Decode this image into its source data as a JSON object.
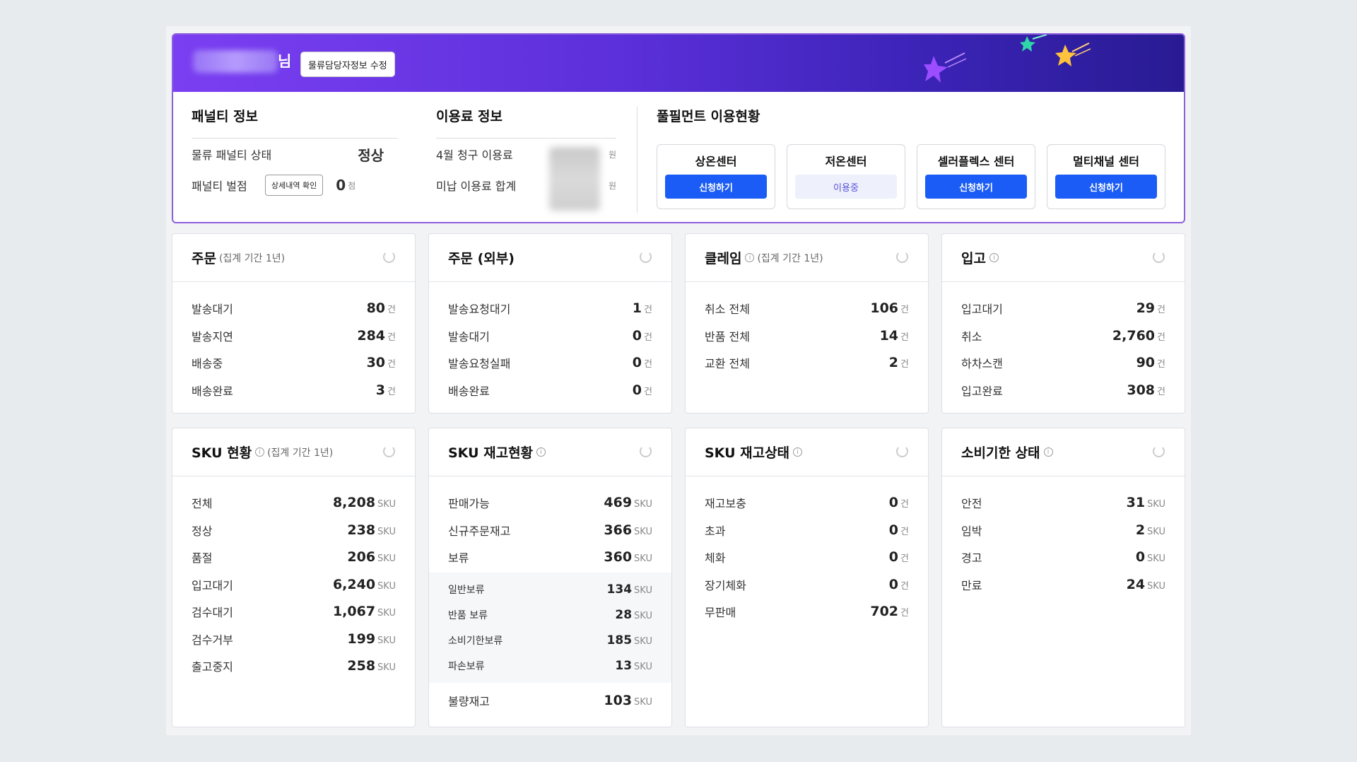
{
  "header": {
    "suffix": "님",
    "edit_button": "물류담당자정보 수정"
  },
  "penalty": {
    "title": "패널티 정보",
    "status_label": "물류 패널티 상태",
    "status_value": "정상",
    "points_label": "패널티 벌점",
    "detail_button": "상세내역 확인",
    "points_value": "0",
    "points_unit": "점"
  },
  "fee": {
    "title": "이용료 정보",
    "row1_label": "4월 청구 이용료",
    "row1_unit": "원",
    "row2_label": "미납 이용료 합계",
    "row2_unit": "원"
  },
  "fulfillment": {
    "title": "풀필먼트 이용현황",
    "centers": [
      {
        "name": "상온센터",
        "button": "신청하기"
      },
      {
        "name": "저온센터",
        "button": "이용중"
      },
      {
        "name": "셀러플렉스 센터",
        "button": "신청하기"
      },
      {
        "name": "멀티채널 센터",
        "button": "신청하기"
      }
    ]
  },
  "cards": {
    "order": {
      "title": "주문",
      "sub": "(집계 기간 1년)",
      "rows": [
        {
          "label": "발송대기",
          "value": "80",
          "unit": "건"
        },
        {
          "label": "발송지연",
          "value": "284",
          "unit": "건"
        },
        {
          "label": "배송중",
          "value": "30",
          "unit": "건"
        },
        {
          "label": "배송완료",
          "value": "3",
          "unit": "건"
        }
      ]
    },
    "order_ext": {
      "title": "주문 (외부)",
      "rows": [
        {
          "label": "발송요청대기",
          "value": "1",
          "unit": "건"
        },
        {
          "label": "발송대기",
          "value": "0",
          "unit": "건"
        },
        {
          "label": "발송요청실패",
          "value": "0",
          "unit": "건"
        },
        {
          "label": "배송완료",
          "value": "0",
          "unit": "건"
        }
      ]
    },
    "claim": {
      "title": "클레임",
      "sub": "(집계 기간 1년)",
      "rows": [
        {
          "label": "취소 전체",
          "value": "106",
          "unit": "건"
        },
        {
          "label": "반품 전체",
          "value": "14",
          "unit": "건"
        },
        {
          "label": "교환 전체",
          "value": "2",
          "unit": "건"
        }
      ]
    },
    "inbound": {
      "title": "입고",
      "rows": [
        {
          "label": "입고대기",
          "value": "29",
          "unit": "건"
        },
        {
          "label": "취소",
          "value": "2,760",
          "unit": "건"
        },
        {
          "label": "하차스캔",
          "value": "90",
          "unit": "건"
        },
        {
          "label": "입고완료",
          "value": "308",
          "unit": "건"
        }
      ]
    },
    "sku": {
      "title": "SKU 현황",
      "sub": "(집계 기간 1년)",
      "rows": [
        {
          "label": "전체",
          "value": "8,208",
          "unit": "SKU"
        },
        {
          "label": "정상",
          "value": "238",
          "unit": "SKU"
        },
        {
          "label": "품절",
          "value": "206",
          "unit": "SKU"
        },
        {
          "label": "입고대기",
          "value": "6,240",
          "unit": "SKU"
        },
        {
          "label": "검수대기",
          "value": "1,067",
          "unit": "SKU"
        },
        {
          "label": "검수거부",
          "value": "199",
          "unit": "SKU"
        },
        {
          "label": "출고중지",
          "value": "258",
          "unit": "SKU"
        }
      ]
    },
    "sku_stock": {
      "title": "SKU 재고현황",
      "rows": [
        {
          "label": "판매가능",
          "value": "469",
          "unit": "SKU"
        },
        {
          "label": "신규주문재고",
          "value": "366",
          "unit": "SKU"
        },
        {
          "label": "보류",
          "value": "360",
          "unit": "SKU"
        }
      ],
      "sub_rows": [
        {
          "label": "일반보류",
          "value": "134",
          "unit": "SKU"
        },
        {
          "label": "반품 보류",
          "value": "28",
          "unit": "SKU"
        },
        {
          "label": "소비기한보류",
          "value": "185",
          "unit": "SKU"
        },
        {
          "label": "파손보류",
          "value": "13",
          "unit": "SKU"
        }
      ],
      "tail_rows": [
        {
          "label": "불량재고",
          "value": "103",
          "unit": "SKU"
        }
      ]
    },
    "sku_state": {
      "title": "SKU 재고상태",
      "rows": [
        {
          "label": "재고보충",
          "value": "0",
          "unit": "건"
        },
        {
          "label": "초과",
          "value": "0",
          "unit": "건"
        },
        {
          "label": "체화",
          "value": "0",
          "unit": "건"
        },
        {
          "label": "장기체화",
          "value": "0",
          "unit": "건"
        },
        {
          "label": "무판매",
          "value": "702",
          "unit": "건"
        }
      ]
    },
    "expiry": {
      "title": "소비기한 상태",
      "rows": [
        {
          "label": "안전",
          "value": "31",
          "unit": "SKU"
        },
        {
          "label": "임박",
          "value": "2",
          "unit": "SKU"
        },
        {
          "label": "경고",
          "value": "0",
          "unit": "SKU"
        },
        {
          "label": "만료",
          "value": "24",
          "unit": "SKU"
        }
      ]
    }
  }
}
